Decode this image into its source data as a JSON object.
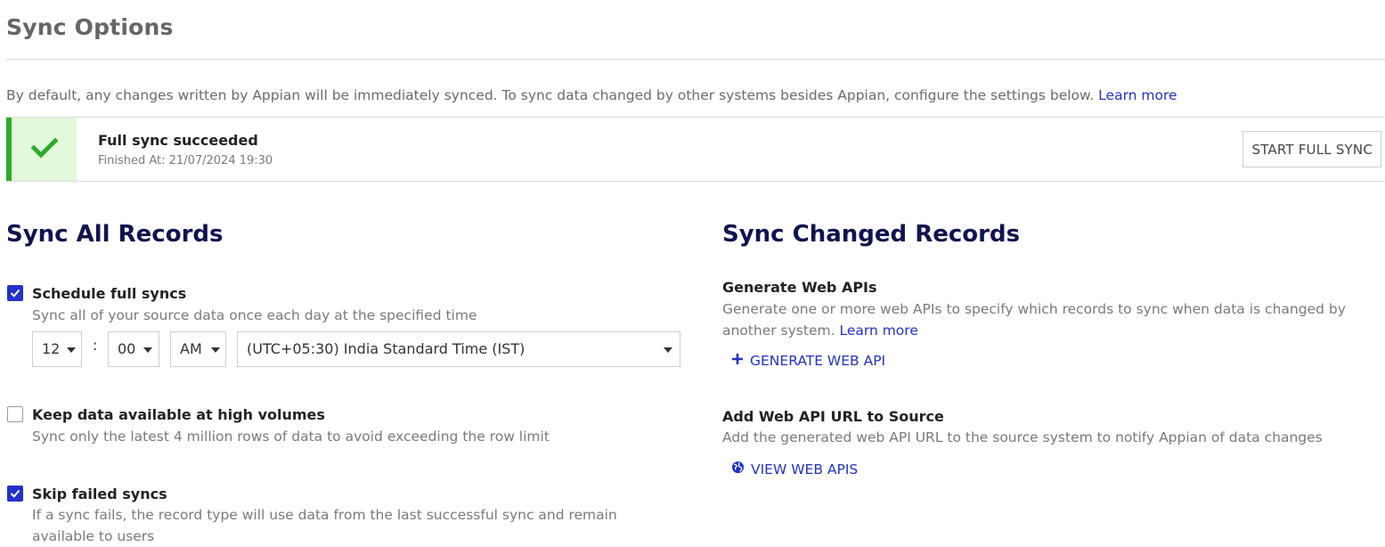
{
  "page": {
    "title": "Sync Options"
  },
  "intro": {
    "text": "By default, any changes written by Appian will be immediately synced. To sync data changed by other systems besides Appian, configure the settings below.",
    "link": "Learn more"
  },
  "status": {
    "title": "Full sync succeeded",
    "finished": "Finished At: 21/07/2024 19:30",
    "button": "START FULL SYNC",
    "accent_color": "#2eaa2e",
    "icon": "check-icon"
  },
  "sync_all": {
    "heading": "Sync All Records",
    "options": [
      {
        "label": "Schedule full syncs",
        "desc": "Sync all of your source data once each day at the specified time",
        "checked": true
      },
      {
        "label": "Keep data available at high volumes",
        "desc": "Sync only the latest 4 million rows of data to avoid exceeding the row limit",
        "checked": false
      },
      {
        "label": "Skip failed syncs",
        "desc": "If a sync fails, the record type will use data from the last successful sync and remain available to users",
        "checked": true
      }
    ],
    "schedule": {
      "hour": "12",
      "separator": ":",
      "minute": "00",
      "ampm": "AM",
      "timezone": "(UTC+05:30) India Standard Time (IST)"
    }
  },
  "sync_changed": {
    "heading": "Sync Changed Records",
    "generate": {
      "label": "Generate Web APIs",
      "desc": "Generate one or more web APIs to specify which records to sync when data is changed by another system.",
      "link": "Learn more",
      "action": "GENERATE WEB API"
    },
    "add_url": {
      "label": "Add Web API URL to Source",
      "desc": "Add the generated web API URL to the source system to notify Appian of data changes",
      "action": "VIEW WEB APIS"
    }
  },
  "colors": {
    "accent": "#2431c9",
    "heading": "#10144f",
    "success": "#2eaa2e"
  }
}
